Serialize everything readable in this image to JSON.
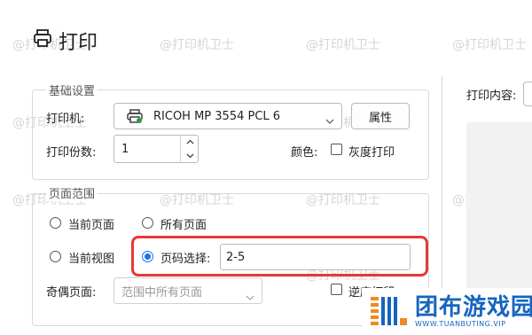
{
  "dialog": {
    "title": "打印"
  },
  "watermarks": [
    "@打印机卫士",
    "@打印机卫士",
    "@打印机卫士",
    "@打印机卫士",
    "@打印机卫士",
    "@打印机卫士",
    "@打印机卫士",
    "@打印机卫士",
    "@打印机卫士",
    "@打印机卫士",
    "@打印机卫士",
    "@打印机卫士"
  ],
  "basic": {
    "legend": "基础设置",
    "printer_label": "打印机:",
    "printer_value": "RICOH MP 3554 PCL 6",
    "properties_button": "属性",
    "copies_label": "打印份数:",
    "copies_value": "1",
    "color_label": "颜色:",
    "grayscale_label": "灰度打印"
  },
  "range": {
    "legend": "页面范围",
    "current_page": "当前页面",
    "all_pages": "所有页面",
    "current_view": "当前视图",
    "page_select_label": "页码选择:",
    "page_select_value": "2-5",
    "odd_even_label": "奇偶页面:",
    "odd_even_value": "范围中所有页面",
    "reverse_label": "逆序打印",
    "selected": "page_select"
  },
  "right": {
    "content_label": "打印内容:"
  },
  "branding": {
    "name": "团布游戏园",
    "url": "WWW.TUANBUTING.VIP"
  },
  "colors": {
    "accent": "#1a73e8",
    "highlight": "#e53935",
    "brand_orange": "#f08a24",
    "brand_blue": "#1565c0"
  }
}
